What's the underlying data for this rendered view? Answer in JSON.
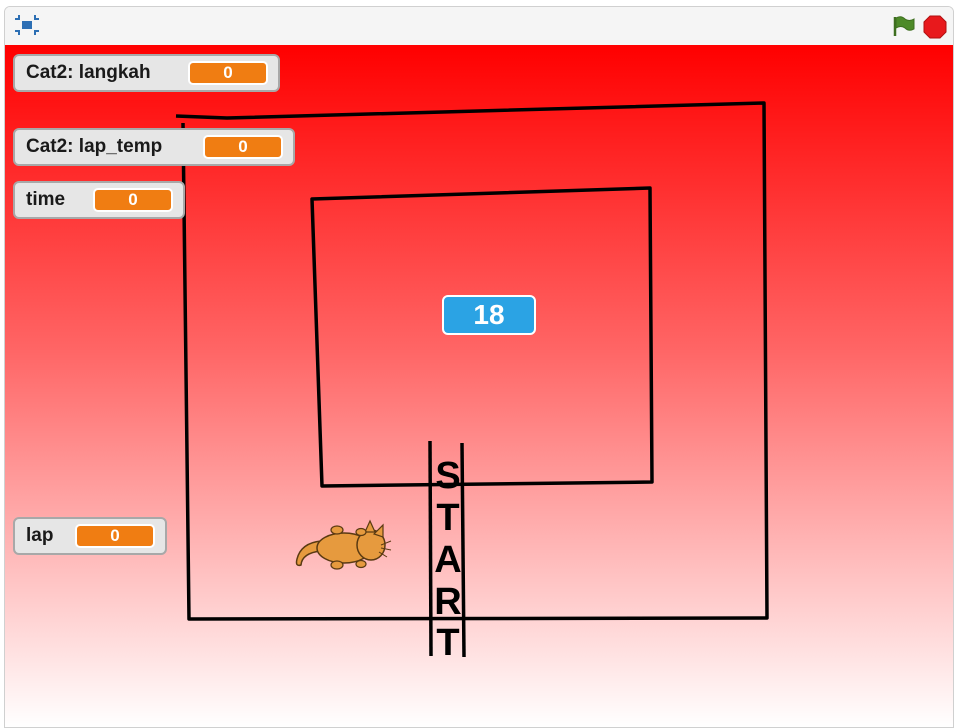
{
  "toolbar": {
    "fullscreen_icon": "fullscreen-icon",
    "flag_icon": "green-flag-icon",
    "stop_icon": "stop-icon",
    "flag_color": "#4d8a28",
    "stop_color": "#e8191c"
  },
  "monitors": {
    "langkah": {
      "label": "Cat2: langkah",
      "value": "0"
    },
    "lap_temp": {
      "label": "Cat2: lap_temp",
      "value": "0"
    },
    "time": {
      "label": "time",
      "value": "0"
    },
    "lap": {
      "label": "lap",
      "value": "0"
    }
  },
  "readout": {
    "value": "18"
  },
  "track": {
    "start_letters": [
      "S",
      "T",
      "A",
      "R",
      "T"
    ]
  },
  "colors": {
    "stage_top": "#ff0000",
    "stage_bottom": "#ffffff",
    "monitor_value": "#f07d12",
    "readout": "#2ba3e4",
    "cat": "#e69a3e"
  }
}
